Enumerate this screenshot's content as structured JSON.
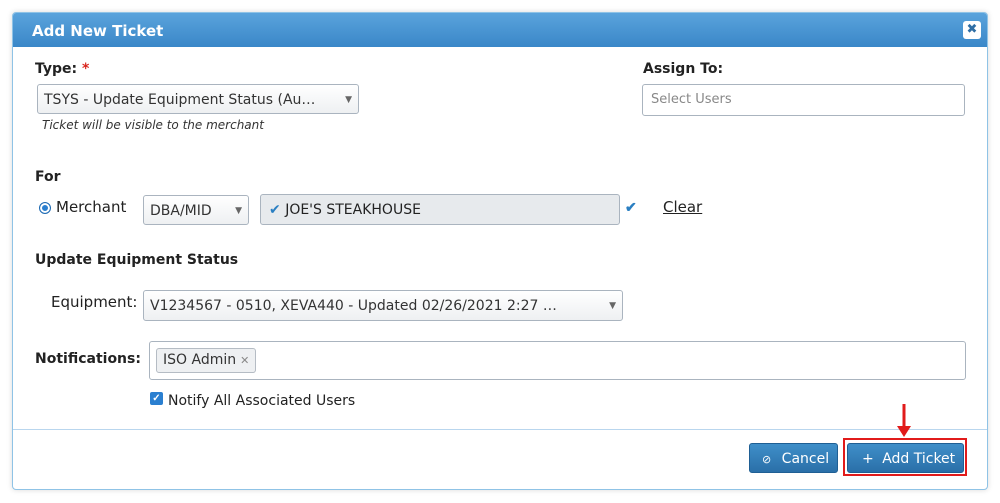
{
  "dialog": {
    "title": "Add New Ticket",
    "close_icon": "✖"
  },
  "type": {
    "label": "Type:",
    "required_mark": "*",
    "selected": "TSYS - Update Equipment Status (Au…",
    "hint": "Ticket will be visible to the merchant"
  },
  "assign": {
    "label": "Assign To:",
    "placeholder": "Select Users"
  },
  "for_section": {
    "label": "For",
    "radio_label": "Merchant",
    "lookup_select": "DBA/MID",
    "merchant_value": "JOE'S STEAKHOUSE",
    "clear_link": "Clear"
  },
  "equipment_section": {
    "heading": "Update Equipment Status",
    "label": "Equipment:",
    "selected": "V1234567 - 0510, XEVA440 - Updated 02/26/2021 2:27 …"
  },
  "notifications": {
    "label": "Notifications:",
    "tags": [
      "ISO Admin"
    ],
    "notify_all_label": "Notify All Associated Users"
  },
  "footer": {
    "cancel_label": "Cancel",
    "add_label": "Add Ticket"
  },
  "colors": {
    "accent": "#3a87c8",
    "highlight": "#e11b1b"
  }
}
